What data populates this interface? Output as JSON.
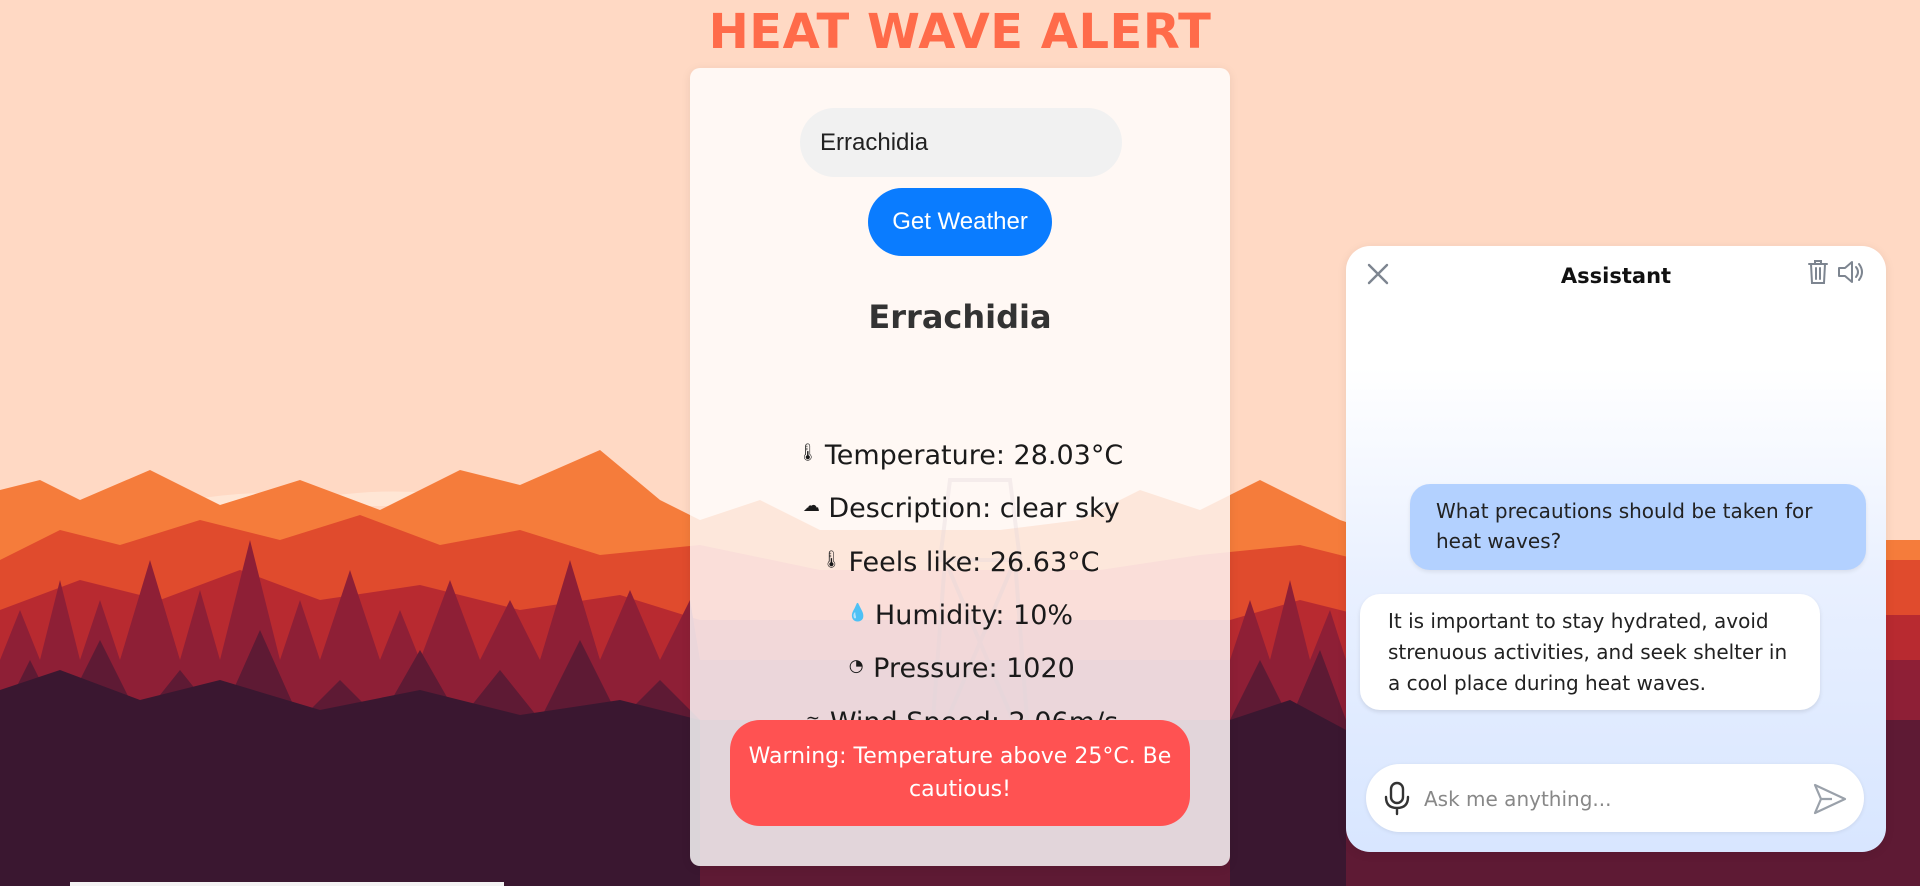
{
  "page": {
    "title": "HEAT WAVE ALERT"
  },
  "weather": {
    "city_input_value": "Errachidia",
    "get_button_label": "Get Weather",
    "city_name": "Errachidia",
    "stats": [
      {
        "icon": "thermometer-icon",
        "text": "Temperature: 28.03°C"
      },
      {
        "icon": "cloud-icon",
        "text": "Description: clear sky"
      },
      {
        "icon": "thermometer-icon",
        "text": "Feels like: 26.63°C"
      },
      {
        "icon": "droplet-icon",
        "text": "Humidity: 10%"
      },
      {
        "icon": "gauge-icon",
        "text": "Pressure: 1020"
      },
      {
        "icon": "wind-icon",
        "text": "Wind Speed: 2.06m/s"
      }
    ],
    "warning": "Warning: Temperature above 25°C. Be cautious!"
  },
  "assistant": {
    "title": "Assistant",
    "messages": [
      {
        "role": "user",
        "text": "What precautions should be taken for heat waves?"
      },
      {
        "role": "bot",
        "text": "It is important to stay hydrated, avoid strenuous activities, and seek shelter in a cool place during heat waves."
      }
    ],
    "input_placeholder": "Ask me anything..."
  },
  "colors": {
    "title": "#ff6b4a",
    "button": "#0a7cff",
    "warning": "#ff5252",
    "user_bubble": "#b3d1ff",
    "sky": "#ffd9c4"
  }
}
